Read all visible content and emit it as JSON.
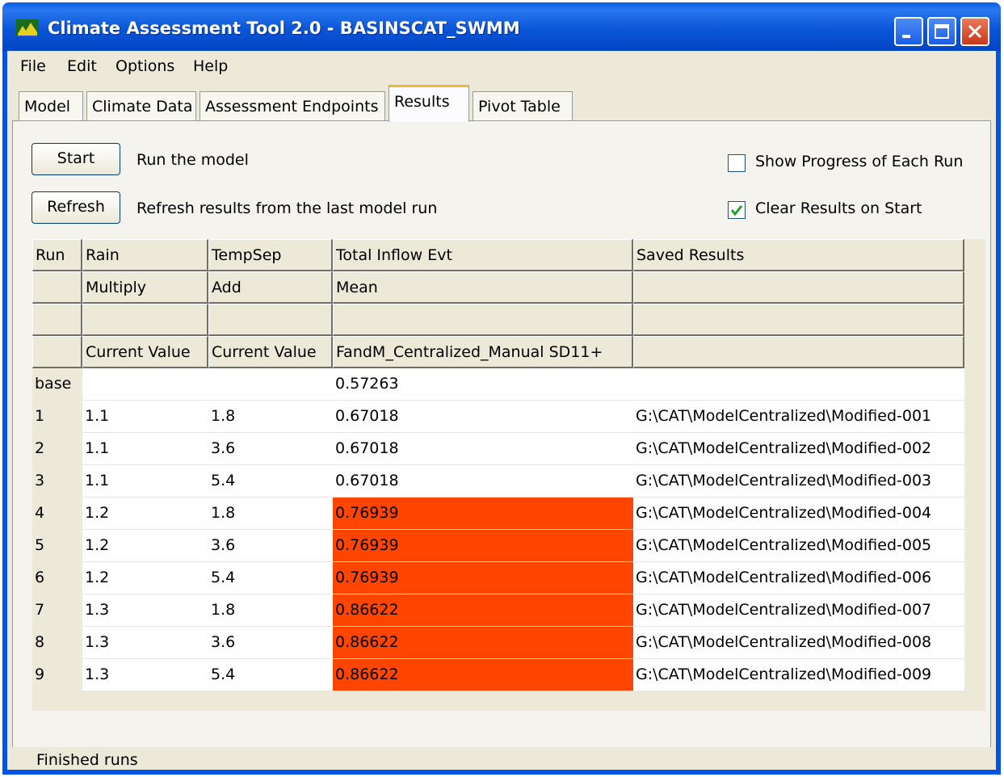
{
  "window": {
    "title": "Climate Assessment Tool 2.0 - BASINSCAT_SWMM"
  },
  "menu": [
    "File",
    "Edit",
    "Options",
    "Help"
  ],
  "tabs": [
    "Model",
    "Climate Data",
    "Assessment Endpoints",
    "Results",
    "Pivot Table"
  ],
  "active_tab": "Results",
  "controls": {
    "start_label": "Start",
    "start_desc": "Run the model",
    "refresh_label": "Refresh",
    "refresh_desc": "Refresh results from the last model run",
    "show_progress_label": "Show Progress of Each Run",
    "show_progress_checked": false,
    "clear_results_label": "Clear Results on Start",
    "clear_results_checked": true
  },
  "table": {
    "header_rows": [
      [
        "Run",
        "Rain",
        "TempSep",
        "Total Inflow Evt",
        "Saved Results"
      ],
      [
        "",
        "Multiply",
        "Add",
        "Mean",
        ""
      ],
      [
        "",
        "",
        "",
        "",
        ""
      ],
      [
        "",
        "Current Value",
        "Current Value",
        "FandM_Centralized_Manual SD11+",
        ""
      ]
    ],
    "rows": [
      [
        "base",
        "",
        "",
        "0.57263",
        ""
      ],
      [
        "1",
        "1.1",
        "1.8",
        "0.67018",
        "G:\\CAT\\ModelCentralized\\Modified-001"
      ],
      [
        "2",
        "1.1",
        "3.6",
        "0.67018",
        "G:\\CAT\\ModelCentralized\\Modified-002"
      ],
      [
        "3",
        "1.1",
        "5.4",
        "0.67018",
        "G:\\CAT\\ModelCentralized\\Modified-003"
      ],
      [
        "4",
        "1.2",
        "1.8",
        "0.76939",
        "G:\\CAT\\ModelCentralized\\Modified-004"
      ],
      [
        "5",
        "1.2",
        "3.6",
        "0.76939",
        "G:\\CAT\\ModelCentralized\\Modified-005"
      ],
      [
        "6",
        "1.2",
        "5.4",
        "0.76939",
        "G:\\CAT\\ModelCentralized\\Modified-006"
      ],
      [
        "7",
        "1.3",
        "1.8",
        "0.86622",
        "G:\\CAT\\ModelCentralized\\Modified-007"
      ],
      [
        "8",
        "1.3",
        "3.6",
        "0.86622",
        "G:\\CAT\\ModelCentralized\\Modified-008"
      ],
      [
        "9",
        "1.3",
        "5.4",
        "0.86622",
        "G:\\CAT\\ModelCentralized\\Modified-009"
      ]
    ],
    "highlight_rows": [
      4,
      5,
      6,
      7,
      8,
      9
    ],
    "highlight_color": "#ff4500"
  },
  "status": {
    "text": "Finished runs"
  }
}
